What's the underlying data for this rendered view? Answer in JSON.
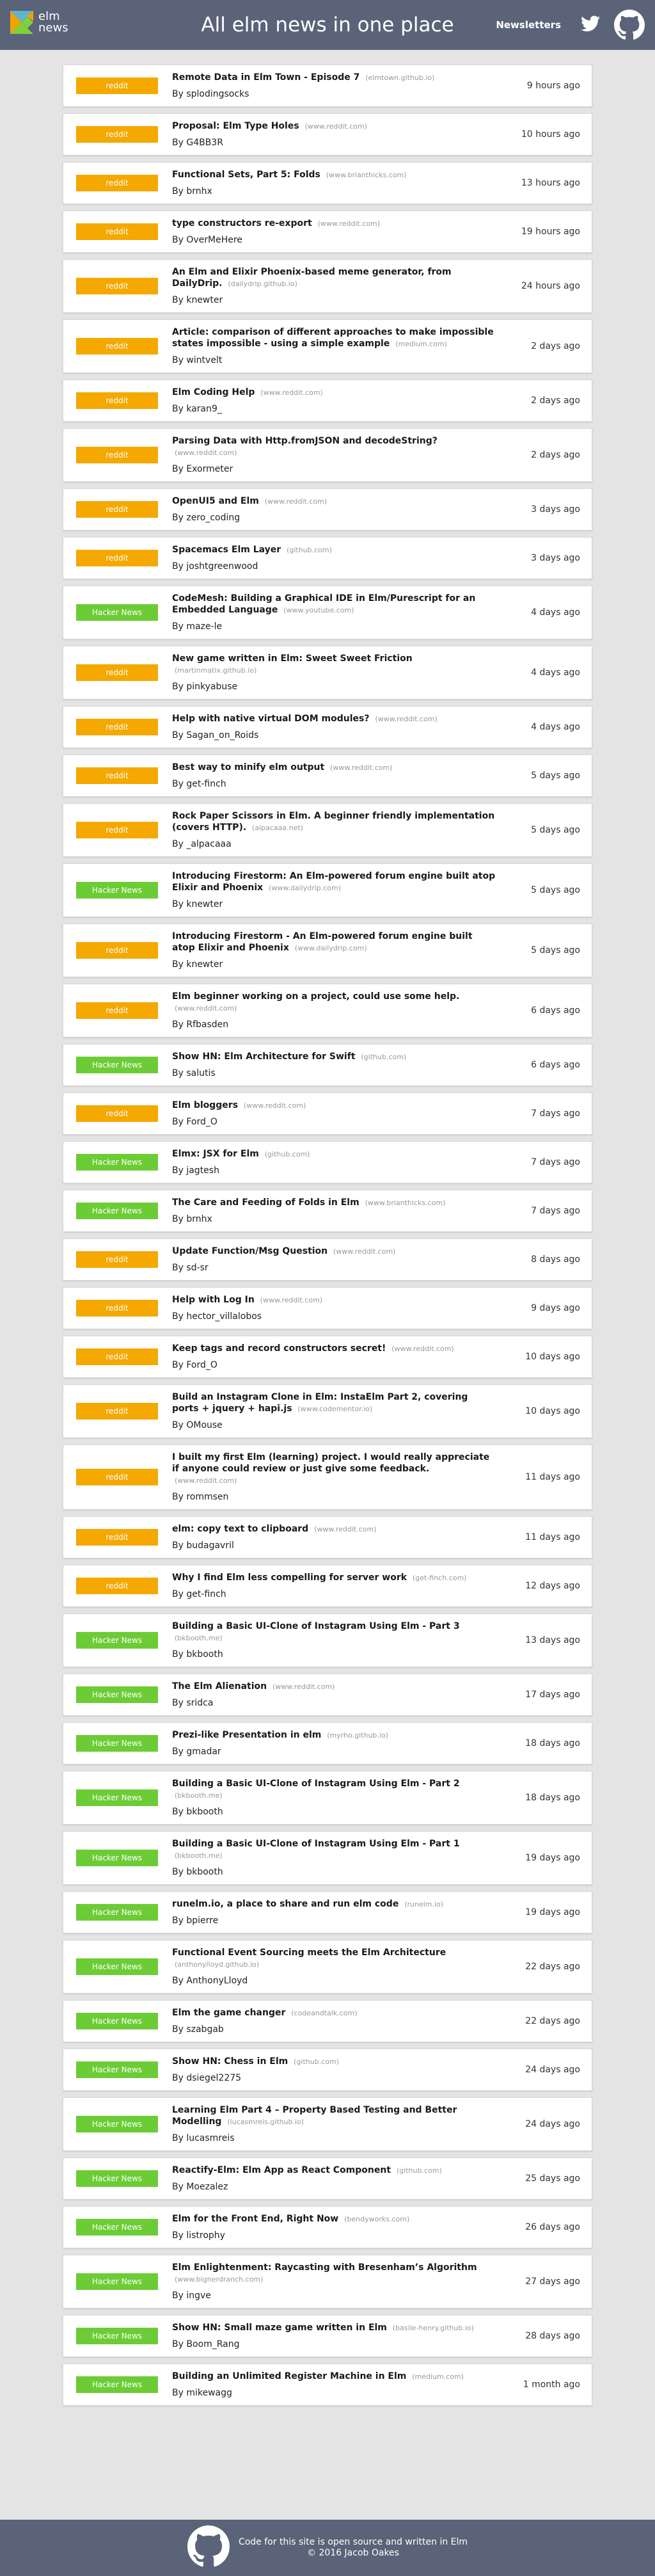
{
  "header": {
    "logo_line1": "elm",
    "logo_line2": "news",
    "title": "All elm news in one place",
    "newsletters_label": "Newsletters"
  },
  "colors": {
    "header_bg": "#5a6378",
    "reddit": "#f4a800",
    "hacker_news": "#6ccc35",
    "page_bg": "#e4e4e4"
  },
  "icons": {
    "logo": "elm-tangram-icon",
    "twitter": "twitter-icon",
    "github": "github-icon"
  },
  "items": [
    {
      "source": "reddit",
      "title": "Remote Data in Elm Town - Episode 7",
      "domain": "(elmtown.github.io)",
      "author": "By splodingsocks",
      "age": "9 hours ago"
    },
    {
      "source": "reddit",
      "title": "Proposal: Elm Type Holes",
      "domain": "(www.reddit.com)",
      "author": "By G4BB3R",
      "age": "10 hours ago"
    },
    {
      "source": "reddit",
      "title": "Functional Sets, Part 5: Folds",
      "domain": "(www.brianthicks.com)",
      "author": "By brnhx",
      "age": "13 hours ago"
    },
    {
      "source": "reddit",
      "title": "type constructors re-export",
      "domain": "(www.reddit.com)",
      "author": "By OverMeHere",
      "age": "19 hours ago"
    },
    {
      "source": "reddit",
      "title": "An Elm and Elixir Phoenix-based meme generator, from DailyDrip.",
      "domain": "(dailydrip.github.io)",
      "author": "By knewter",
      "age": "24 hours ago"
    },
    {
      "source": "reddit",
      "title": "Article: comparison of different approaches to make impossible states impossible - using a simple example",
      "domain": "(medium.com)",
      "author": "By wintvelt",
      "age": "2 days ago"
    },
    {
      "source": "reddit",
      "title": "Elm Coding Help",
      "domain": "(www.reddit.com)",
      "author": "By karan9_",
      "age": "2 days ago"
    },
    {
      "source": "reddit",
      "title": "Parsing Data with Http.fromJSON and decodeString?",
      "domain": "(www.reddit.com)",
      "author": "By Exormeter",
      "age": "2 days ago"
    },
    {
      "source": "reddit",
      "title": "OpenUI5 and Elm",
      "domain": "(www.reddit.com)",
      "author": "By zero_coding",
      "age": "3 days ago"
    },
    {
      "source": "reddit",
      "title": "Spacemacs Elm Layer",
      "domain": "(github.com)",
      "author": "By joshtgreenwood",
      "age": "3 days ago"
    },
    {
      "source": "hn",
      "title": "CodeMesh: Building a Graphical IDE in Elm/Purescript for an Embedded Language",
      "domain": "(www.youtube.com)",
      "author": "By maze-le",
      "age": "4 days ago"
    },
    {
      "source": "reddit",
      "title": "New game written in Elm: Sweet Sweet Friction",
      "domain": "(martinmatix.github.io)",
      "author": "By pinkyabuse",
      "age": "4 days ago"
    },
    {
      "source": "reddit",
      "title": "Help with native virtual DOM modules?",
      "domain": "(www.reddit.com)",
      "author": "By Sagan_on_Roids",
      "age": "4 days ago"
    },
    {
      "source": "reddit",
      "title": "Best way to minify elm output",
      "domain": "(www.reddit.com)",
      "author": "By get-finch",
      "age": "5 days ago"
    },
    {
      "source": "reddit",
      "title": "Rock Paper Scissors in Elm. A beginner friendly implementation (covers HTTP).",
      "domain": "(alpacaaa.net)",
      "author": "By _alpacaaa",
      "age": "5 days ago"
    },
    {
      "source": "hn",
      "title": "Introducing Firestorm: An Elm-powered forum engine built atop Elixir and Phoenix",
      "domain": "(www.dailydrip.com)",
      "author": "By knewter",
      "age": "5 days ago"
    },
    {
      "source": "reddit",
      "title": "Introducing Firestorm - An Elm-powered forum engine built atop Elixir and Phoenix",
      "domain": "(www.dailydrip.com)",
      "author": "By knewter",
      "age": "5 days ago"
    },
    {
      "source": "reddit",
      "title": "Elm beginner working on a project, could use some help.",
      "domain": "(www.reddit.com)",
      "author": "By Rfbasden",
      "age": "6 days ago"
    },
    {
      "source": "hn",
      "title": "Show HN: Elm Architecture for Swift",
      "domain": "(github.com)",
      "author": "By salutis",
      "age": "6 days ago"
    },
    {
      "source": "reddit",
      "title": "Elm bloggers",
      "domain": "(www.reddit.com)",
      "author": "By Ford_O",
      "age": "7 days ago"
    },
    {
      "source": "hn",
      "title": "Elmx: JSX for Elm",
      "domain": "(github.com)",
      "author": "By jagtesh",
      "age": "7 days ago"
    },
    {
      "source": "hn",
      "title": "The Care and Feeding of Folds in Elm",
      "domain": "(www.brianthicks.com)",
      "author": "By brnhx",
      "age": "7 days ago"
    },
    {
      "source": "reddit",
      "title": "Update Function/Msg Question",
      "domain": "(www.reddit.com)",
      "author": "By sd-sr",
      "age": "8 days ago"
    },
    {
      "source": "reddit",
      "title": "Help with Log In",
      "domain": "(www.reddit.com)",
      "author": "By hector_villalobos",
      "age": "9 days ago"
    },
    {
      "source": "reddit",
      "title": "Keep tags and record constructors secret!",
      "domain": "(www.reddit.com)",
      "author": "By Ford_O",
      "age": "10 days ago"
    },
    {
      "source": "reddit",
      "title": "Build an Instagram Clone in Elm: InstaElm Part 2, covering ports + jquery + hapi.js",
      "domain": "(www.codementor.io)",
      "author": "By OMouse",
      "age": "10 days ago"
    },
    {
      "source": "reddit",
      "title": "I built my first Elm (learning) project. I would really appreciate if anyone could review or just give some feedback.",
      "domain": "(www.reddit.com)",
      "author": "By rommsen",
      "age": "11 days ago"
    },
    {
      "source": "reddit",
      "title": "elm: copy text to clipboard",
      "domain": "(www.reddit.com)",
      "author": "By budagavril",
      "age": "11 days ago"
    },
    {
      "source": "reddit",
      "title": "Why I find Elm less compelling for server work",
      "domain": "(get-finch.com)",
      "author": "By get-finch",
      "age": "12 days ago"
    },
    {
      "source": "hn",
      "title": "Building a Basic UI-Clone of Instagram Using Elm - Part 3",
      "domain": "(bkbooth.me)",
      "author": "By bkbooth",
      "age": "13 days ago"
    },
    {
      "source": "hn",
      "title": "The Elm Alienation",
      "domain": "(www.reddit.com)",
      "author": "By sridca",
      "age": "17 days ago"
    },
    {
      "source": "hn",
      "title": "Prezi-like Presentation in elm",
      "domain": "(myrho.github.io)",
      "author": "By gmadar",
      "age": "18 days ago"
    },
    {
      "source": "hn",
      "title": "Building a Basic UI-Clone of Instagram Using Elm - Part 2",
      "domain": "(bkbooth.me)",
      "author": "By bkbooth",
      "age": "18 days ago"
    },
    {
      "source": "hn",
      "title": "Building a Basic UI-Clone of Instagram Using Elm - Part 1",
      "domain": "(bkbooth.me)",
      "author": "By bkbooth",
      "age": "19 days ago"
    },
    {
      "source": "hn",
      "title": "runelm.io, a place to share and run elm code",
      "domain": "(runelm.io)",
      "author": "By bpierre",
      "age": "19 days ago"
    },
    {
      "source": "hn",
      "title": "Functional Event Sourcing meets the Elm Architecture",
      "domain": "(anthonylloyd.github.io)",
      "author": "By AnthonyLloyd",
      "age": "22 days ago"
    },
    {
      "source": "hn",
      "title": "Elm the game changer",
      "domain": "(codeandtalk.com)",
      "author": "By szabgab",
      "age": "22 days ago"
    },
    {
      "source": "hn",
      "title": "Show HN: Chess in Elm",
      "domain": "(github.com)",
      "author": "By dsiegel2275",
      "age": "24 days ago"
    },
    {
      "source": "hn",
      "title": "Learning Elm Part 4 – Property Based Testing and Better Modelling",
      "domain": "(lucasmreis.github.io)",
      "author": "By lucasmreis",
      "age": "24 days ago"
    },
    {
      "source": "hn",
      "title": "Reactify-Elm: Elm App as React Component",
      "domain": "(github.com)",
      "author": "By Moezalez",
      "age": "25 days ago"
    },
    {
      "source": "hn",
      "title": "Elm for the Front End, Right Now",
      "domain": "(bendyworks.com)",
      "author": "By listrophy",
      "age": "26 days ago"
    },
    {
      "source": "hn",
      "title": "Elm Enlightenment: Raycasting with Bresenham’s Algorithm",
      "domain": "(www.bignerdranch.com)",
      "author": "By ingve",
      "age": "27 days ago"
    },
    {
      "source": "hn",
      "title": "Show HN: Small maze game written in Elm",
      "domain": "(basile-henry.github.io)",
      "author": "By Boom_Rang",
      "age": "28 days ago"
    },
    {
      "source": "hn",
      "title": "Building an Unlimited Register Machine in Elm",
      "domain": "(medium.com)",
      "author": "By mikewagg",
      "age": "1 month ago"
    }
  ],
  "source_labels": {
    "reddit": "reddit",
    "hn": "Hacker News"
  },
  "footer": {
    "line1": "Code for this site is open source and written in Elm",
    "line2": "© 2016 Jacob Oakes"
  }
}
